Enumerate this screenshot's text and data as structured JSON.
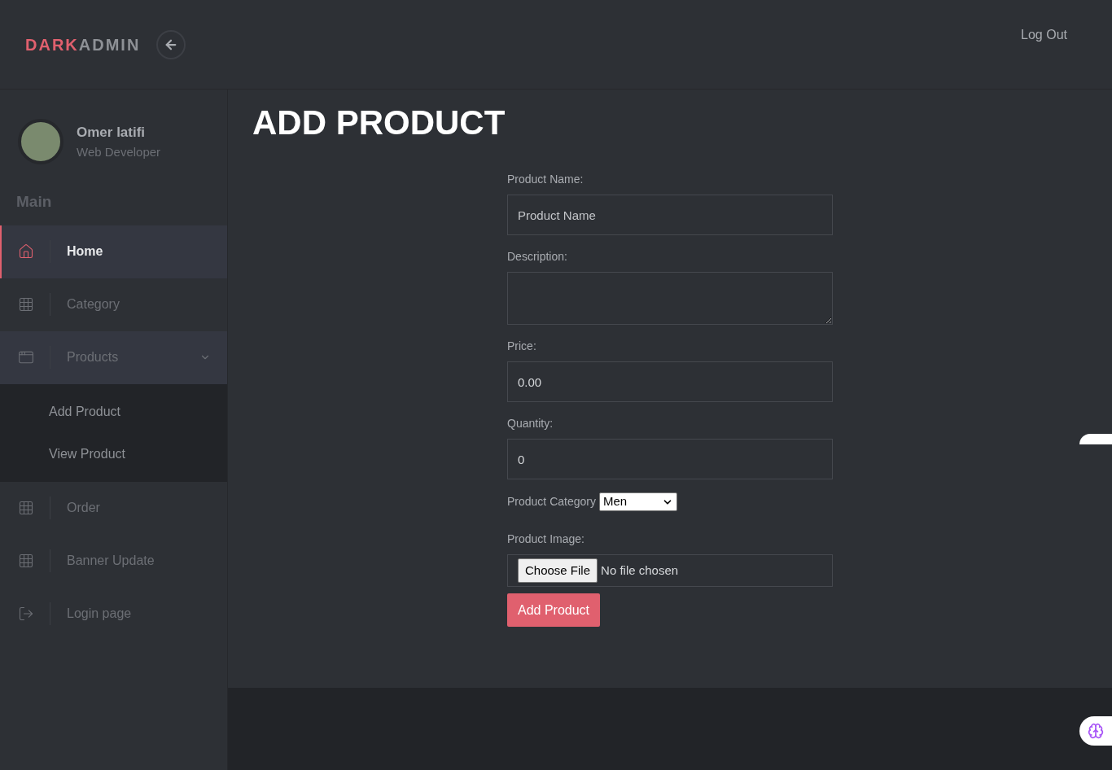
{
  "brand": {
    "first": "DARK",
    "second": "ADMIN"
  },
  "header": {
    "logout": "Log Out"
  },
  "profile": {
    "name": "Omer latifi",
    "role": "Web Developer"
  },
  "sidebar": {
    "heading": "Main",
    "items": [
      {
        "label": "Home",
        "kind": "home",
        "selected": true
      },
      {
        "label": "Category",
        "kind": "grid",
        "selected": false
      },
      {
        "label": "Products",
        "kind": "windows",
        "selected": false,
        "expanded": true,
        "children": [
          {
            "label": "Add Product"
          },
          {
            "label": "View Product"
          }
        ]
      },
      {
        "label": "Order",
        "kind": "grid",
        "selected": false
      },
      {
        "label": "Banner Update",
        "kind": "grid",
        "selected": false
      },
      {
        "label": "Login page",
        "kind": "exit",
        "selected": false
      }
    ]
  },
  "page": {
    "title": "ADD PRODUCT"
  },
  "form": {
    "fields": [
      {
        "kind": "text",
        "label": "Product Name:",
        "placeholder": "Product Name"
      },
      {
        "kind": "textarea",
        "label": "Description:"
      },
      {
        "kind": "text",
        "label": "Price:",
        "value": "0.00"
      },
      {
        "kind": "text",
        "label": "Quantity:",
        "value": "0"
      },
      {
        "kind": "select",
        "label": "Product Category",
        "value": "Men"
      },
      {
        "kind": "file",
        "label": "Product Image:",
        "button": "Choose File",
        "status": "No file chosen"
      }
    ],
    "submit": "Add Product"
  }
}
